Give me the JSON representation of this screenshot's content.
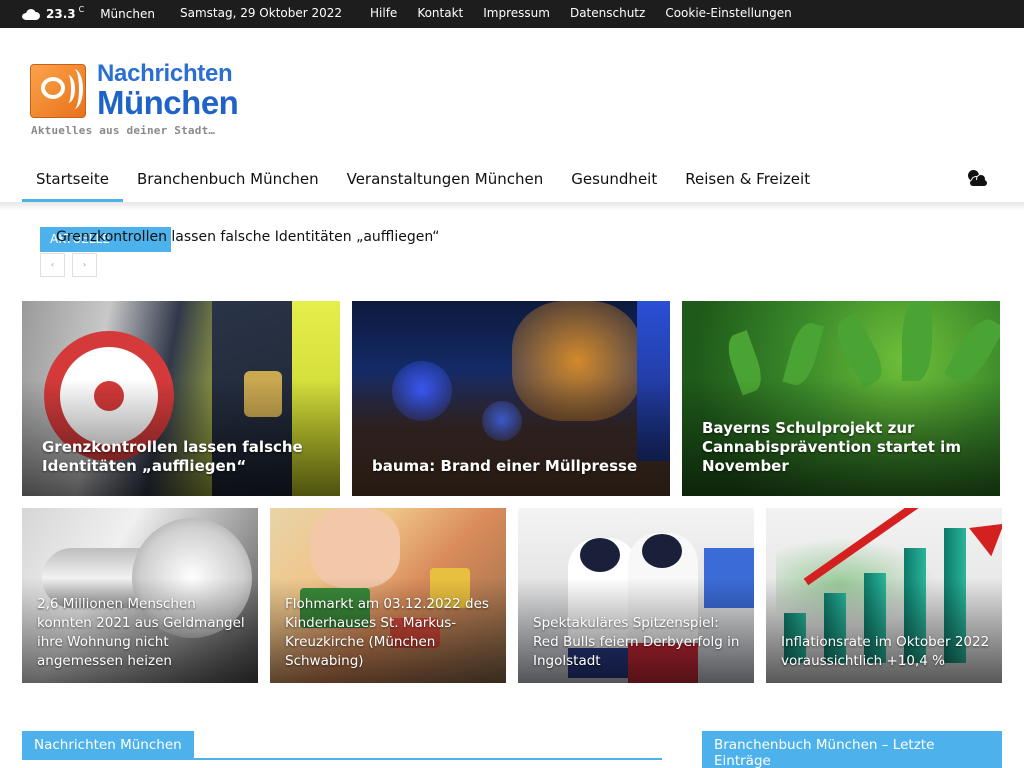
{
  "topbar": {
    "weather_icon": "cloud-icon",
    "temperature": "23.3",
    "temperature_unit": "C",
    "city": "München",
    "date": "Samstag, 29 Oktober 2022",
    "links": [
      "Hilfe",
      "Kontakt",
      "Impressum",
      "Datenschutz",
      "Cookie-Einstellungen"
    ]
  },
  "logo": {
    "title_line1": "Nachrichten",
    "title_line2": "München",
    "tagline": "Aktuelles aus deiner Stadt…"
  },
  "nav": {
    "items": [
      {
        "label": "Startseite",
        "active": true
      },
      {
        "label": "Branchenbuch München",
        "active": false
      },
      {
        "label": "Veranstaltungen München",
        "active": false
      },
      {
        "label": "Gesundheit",
        "active": false
      },
      {
        "label": "Reisen & Freizeit",
        "active": false
      }
    ],
    "weather_icon": "sun-cloud-icon"
  },
  "ticker": {
    "badge": "AKTUELLE NACHRICHTEN",
    "headline": "Grenzkontrollen lassen falsche Identitäten „auffliegen“",
    "prev_label": "‹",
    "next_label": "›"
  },
  "tiles_big": [
    {
      "title": "Grenzkontrollen lassen falsche Identitäten „auffliegen“"
    },
    {
      "title": "bauma: Brand einer Müllpresse"
    },
    {
      "title": "Bayerns Schulprojekt zur Cannabisprävention startet im November"
    }
  ],
  "tiles_small": [
    {
      "title": "2,6 Millionen Menschen konnten 2021 aus Geldmangel ihre Wohnung nicht angemessen heizen"
    },
    {
      "title": "Flohmarkt am 03.12.2022 des Kinderhauses St. Markus-Kreuzkirche (München Schwabing)"
    },
    {
      "title": "Spektakuläres Spitzenspiel: Red Bulls feiern Derbyerfolg in Ingolstadt"
    },
    {
      "title": "Inflationsrate im Oktober 2022 voraussichtlich +10,4 %"
    }
  ],
  "sections": {
    "left_title": "Nachrichten München",
    "right_title": "Branchenbuch München – Letzte Einträge"
  },
  "colors": {
    "accent": "#4db2ec",
    "topbar": "#1d1d1d"
  }
}
